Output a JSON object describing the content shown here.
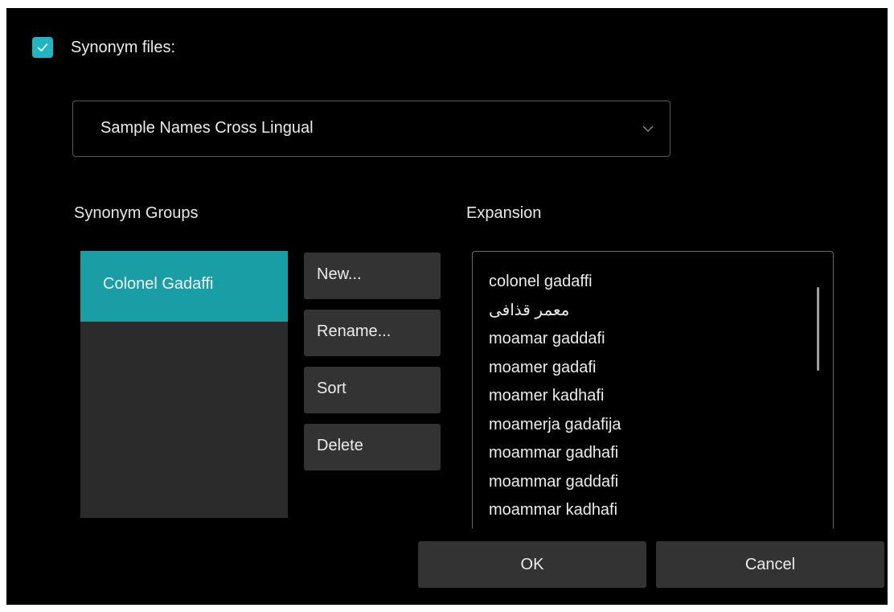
{
  "synonym_files": {
    "checked": true,
    "label": "Synonym files:",
    "selected_file": "Sample Names Cross Lingual"
  },
  "groups": {
    "header": "Synonym Groups",
    "items": [
      {
        "label": "Colonel Gadaffi",
        "selected": true
      }
    ]
  },
  "group_actions": {
    "new_label": "New...",
    "rename_label": "Rename...",
    "sort_label": "Sort",
    "delete_label": "Delete"
  },
  "expansion": {
    "header": "Expansion",
    "items": [
      "colonel gadaffi",
      "معمر قذافى",
      "moamar gaddafi",
      "moamer gadafi",
      "moamer kadhafi",
      "moamerja gadafija",
      "moammar gadhafi",
      "moammar gaddafi",
      "moammar kadhafi"
    ]
  },
  "footer": {
    "ok_label": "OK",
    "cancel_label": "Cancel"
  },
  "colors": {
    "accent": "#24b3c2",
    "selection": "#1a9ea6",
    "background": "#000000",
    "button": "#333333"
  }
}
